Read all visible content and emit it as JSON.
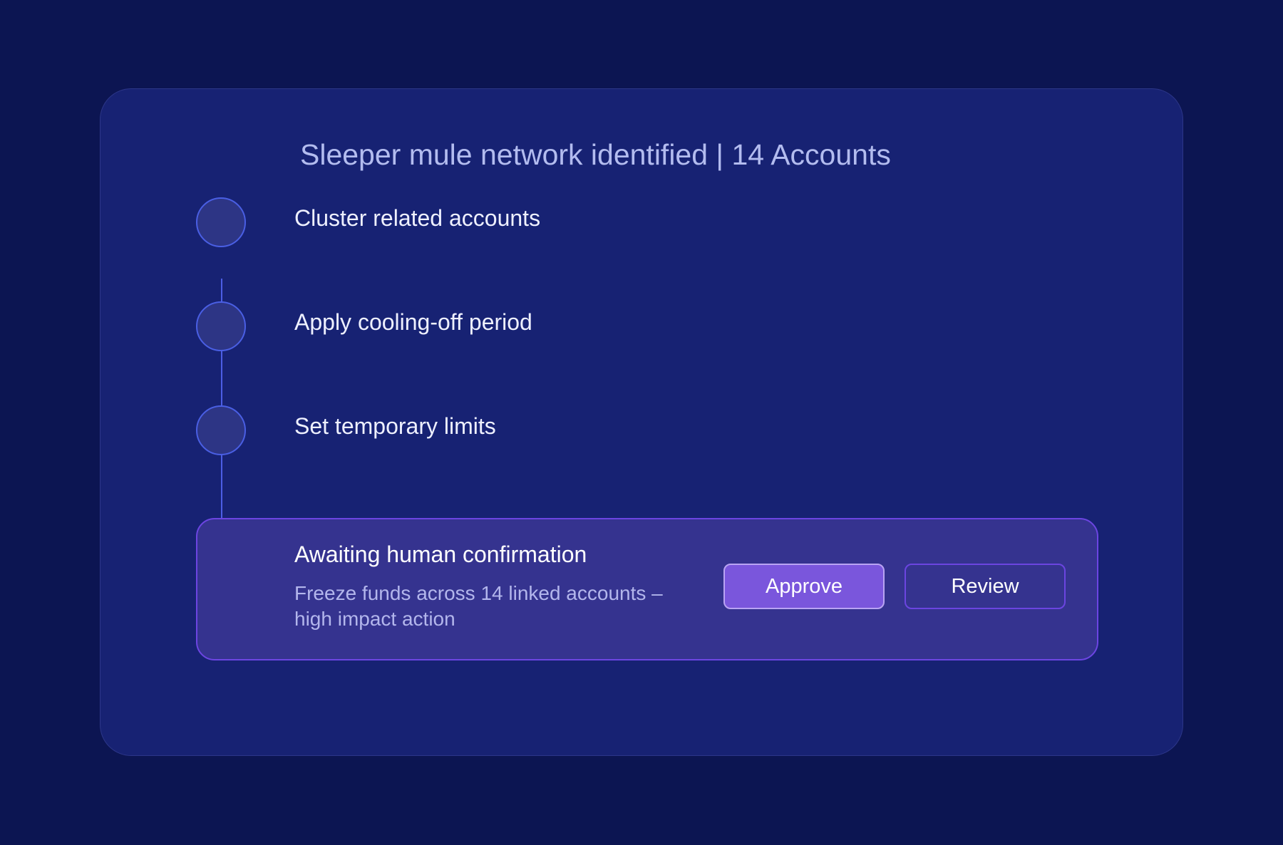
{
  "card": {
    "title": "Sleeper mule network identified | 14 Accounts"
  },
  "steps": [
    {
      "label": "Cluster related accounts"
    },
    {
      "label": "Apply cooling-off period"
    },
    {
      "label": "Set temporary limits"
    }
  ],
  "confirmation": {
    "title": "Awaiting human confirmation",
    "description": "Freeze funds across 14 linked accounts – high impact action",
    "approve_label": "Approve",
    "review_label": "Review"
  },
  "colors": {
    "page_background": "#0c1552",
    "card_background": "#172273",
    "step_node": "#2d3585",
    "accent_line": "#4c5ee4",
    "panel_background": "#35338f",
    "panel_border": "#6c45e2",
    "approve_button": "#7a56dc"
  }
}
